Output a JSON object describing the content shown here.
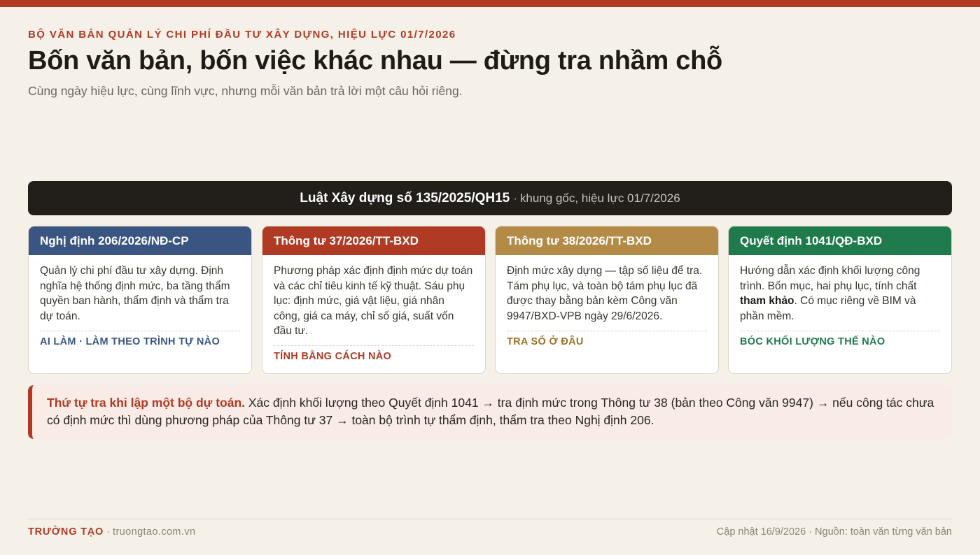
{
  "header": {
    "eyebrow": "BỘ VĂN BẢN QUẢN LÝ CHI PHÍ ĐẦU TƯ XÂY DỰNG, HIỆU LỰC 01/7/2026",
    "title": "Bốn văn bản, bốn việc khác nhau — đừng tra nhầm chỗ",
    "subtitle": "Cùng ngày hiệu lực, cùng lĩnh vực, nhưng mỗi văn bản trả lời một câu hỏi riêng."
  },
  "law_bar": {
    "title": "Luật Xây dựng số 135/2025/QH15",
    "separator": "·",
    "note": "khung gốc, hiệu lực 01/7/2026"
  },
  "cards": [
    {
      "title": "Nghị định 206/2026/NĐ-CP",
      "body": "Quản lý chi phí đầu tư xây dựng. Định nghĩa hệ thống định mức, ba tầng thẩm quyền ban hành, thẩm định và thẩm tra dự toán.",
      "tag": "AI LÀM · LÀM THEO TRÌNH TỰ NÀO",
      "color": "#3a5582"
    },
    {
      "title": "Thông tư 37/2026/TT-BXD",
      "body": "Phương pháp xác định định mức dự toán và các chỉ tiêu kinh tế kỹ thuật. Sáu phụ lục: định mức, giá vật liệu, giá nhân công, giá ca máy, chỉ số giá, suất vốn đầu tư.",
      "tag": "TÍNH BẰNG CÁCH NÀO",
      "color": "#b13a24"
    },
    {
      "title": "Thông tư 38/2026/TT-BXD",
      "body": "Định mức xây dựng — tập số liệu để tra. Tám phụ lục, và toàn bộ tám phụ lục đã được thay bằng bản kèm Công văn 9947/BXD-VPB ngày 29/6/2026.",
      "tag": "TRA SỐ Ở ĐÂU",
      "color": "#b48a47"
    },
    {
      "title": "Quyết định 1041/QĐ-BXD",
      "body_before": "Hướng dẫn xác định khối lượng công trình. Bốn mục, hai phụ lục, tính chất ",
      "body_bold": "tham khảo",
      "body_after": ". Có mục riêng về BIM và phần mềm.",
      "tag": "BÓC KHỐI LƯỢNG THẾ NÀO",
      "color": "#1f7a4c"
    }
  ],
  "callout": {
    "lead": "Thứ tự tra khi lập một bộ dự toán.",
    "text": " Xác định khối lượng theo Quyết định 1041 → tra định mức trong Thông tư 38 (bản theo Công văn 9947) → nếu công tác chưa có định mức thì dùng phương pháp của Thông tư 37 → toàn bộ trình tự thẩm định, thẩm tra theo Nghị định 206."
  },
  "footer": {
    "brand": "TRƯỜNG TẠO",
    "separator": " · ",
    "site": "truongtao.com.vn",
    "right": "Cập nhật 16/9/2026 · Nguồn: toàn văn từng văn bản"
  },
  "colors": {
    "accent": "#b13a24",
    "background": "#f5f1e9",
    "dark_bar": "#221f1b"
  }
}
